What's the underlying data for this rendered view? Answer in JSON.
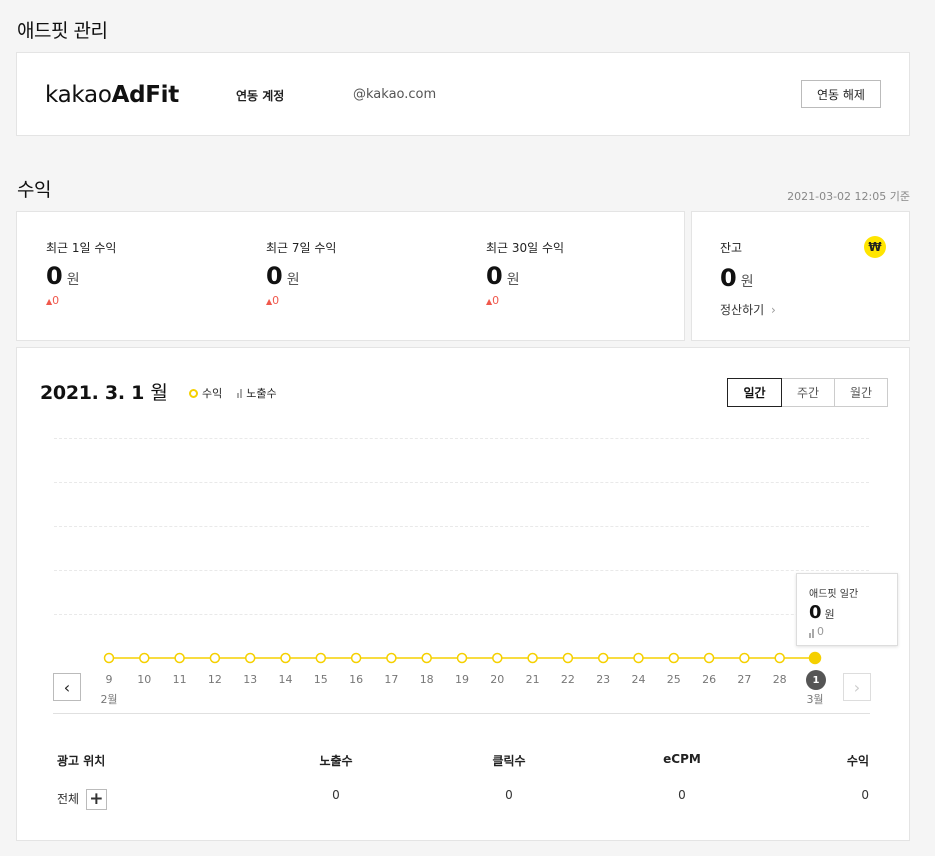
{
  "header": {
    "title": "애드핏 관리"
  },
  "account": {
    "logo_light": "kakao",
    "logo_bold": "AdFit",
    "label": "연동 계정",
    "email": "@kakao.com",
    "unlink_label": "연동 해제"
  },
  "revenue": {
    "title": "수익",
    "timestamp": "2021-03-02 12:05 기준",
    "stats": [
      {
        "label": "최근 1일 수익",
        "value": "0",
        "unit": "원",
        "delta": "0"
      },
      {
        "label": "최근 7일 수익",
        "value": "0",
        "unit": "원",
        "delta": "0"
      },
      {
        "label": "최근 30일 수익",
        "value": "0",
        "unit": "원",
        "delta": "0"
      }
    ],
    "balance": {
      "label": "잔고",
      "value": "0",
      "unit": "원",
      "settle_label": "정산하기",
      "icon_glyph": "₩"
    }
  },
  "chart": {
    "title": "2021. 3. 1",
    "title_suffix": "월",
    "legend": {
      "revenue": "수익",
      "impressions": "노출수"
    },
    "tabs": [
      {
        "label": "일간",
        "active": true
      },
      {
        "label": "주간",
        "active": false
      },
      {
        "label": "월간",
        "active": false
      }
    ],
    "tooltip": {
      "title": "애드핏 일간",
      "value": "0",
      "unit": "원",
      "impressions": "0"
    },
    "selected_badge": "1"
  },
  "chart_data": {
    "type": "line",
    "x": [
      "9",
      "10",
      "11",
      "12",
      "13",
      "14",
      "15",
      "16",
      "17",
      "18",
      "19",
      "20",
      "21",
      "22",
      "23",
      "24",
      "25",
      "26",
      "27",
      "28",
      "1"
    ],
    "month_labels": [
      {
        "index": 0,
        "label": "2월"
      },
      {
        "index": 20,
        "label": "3월"
      }
    ],
    "series": [
      {
        "name": "수익",
        "values": [
          0,
          0,
          0,
          0,
          0,
          0,
          0,
          0,
          0,
          0,
          0,
          0,
          0,
          0,
          0,
          0,
          0,
          0,
          0,
          0,
          0
        ]
      }
    ],
    "selected_index": 20,
    "grid": true,
    "colors": {
      "line": "#f5d000",
      "point_fill": "#ffffff",
      "selected_fill": "#f5d000"
    }
  },
  "table": {
    "headers": [
      "광고 위치",
      "노출수",
      "클릭수",
      "eCPM",
      "수익"
    ],
    "rows": [
      {
        "position": "전체",
        "impressions": "0",
        "clicks": "0",
        "ecpm": "0",
        "revenue": "0"
      }
    ]
  }
}
